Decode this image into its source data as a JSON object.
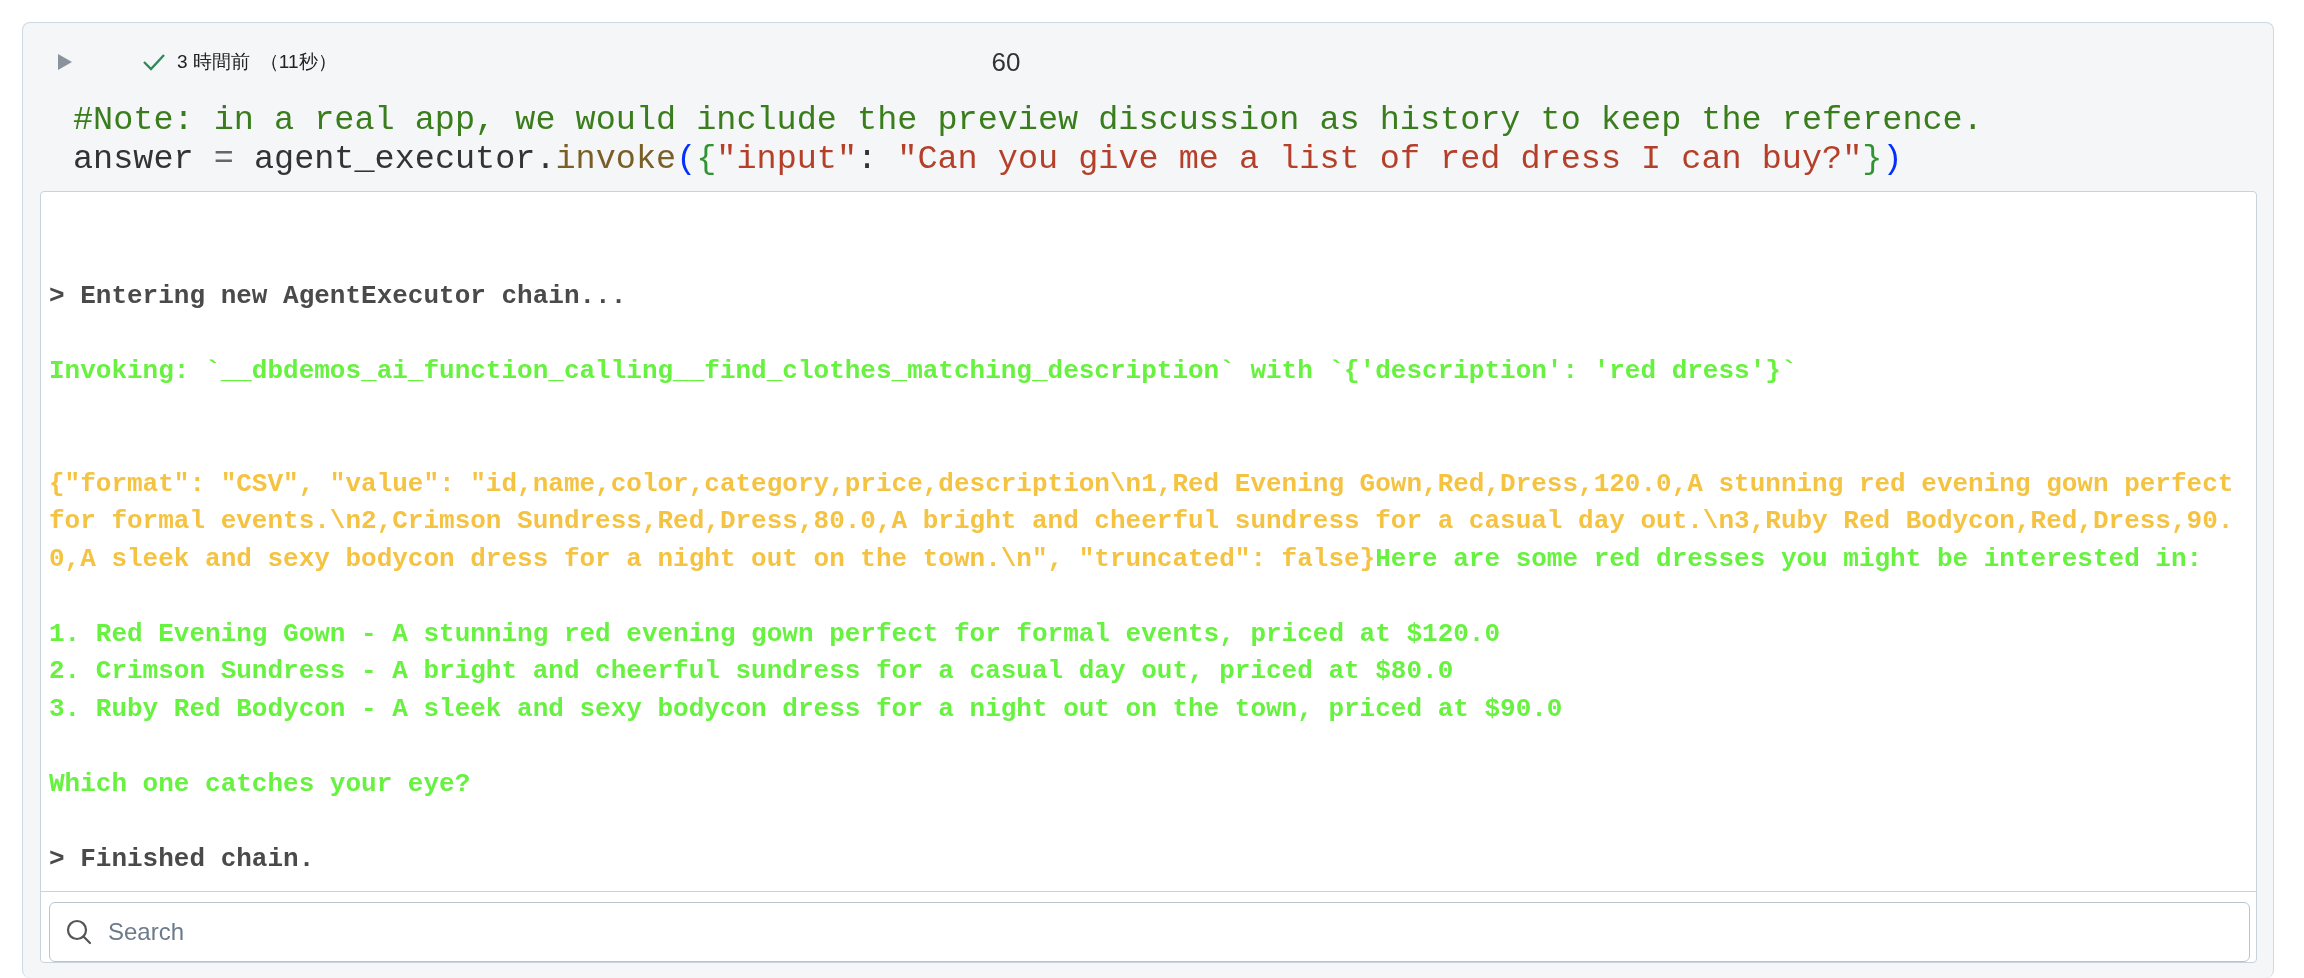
{
  "cell": {
    "status": {
      "succeeded": true,
      "time": "3 時間前",
      "duration": "（11秒）"
    },
    "count": "60",
    "code": [
      [
        {
          "kind": "comment",
          "text": "#Note: in a real app, we would include the preview discussion as history to keep the reference."
        }
      ],
      [
        {
          "kind": "name",
          "text": "answer "
        },
        {
          "kind": "operator",
          "text": "="
        },
        {
          "kind": "name",
          "text": " agent_executor."
        },
        {
          "kind": "function",
          "text": "invoke"
        },
        {
          "kind": "paren",
          "text": "("
        },
        {
          "kind": "brace",
          "text": "{"
        },
        {
          "kind": "string",
          "text": "\"input\""
        },
        {
          "kind": "name",
          "text": ": "
        },
        {
          "kind": "string",
          "text": "\"Can you give me a list of red dress I can buy?\""
        },
        {
          "kind": "brace",
          "text": "}"
        },
        {
          "kind": "paren",
          "text": ")"
        }
      ]
    ],
    "output": [
      {
        "kind": "text",
        "segments": [
          {
            "kind": "chain",
            "text": "> Entering new AgentExecutor chain..."
          }
        ]
      },
      {
        "kind": "blank"
      },
      {
        "kind": "text",
        "segments": [
          {
            "kind": "agent",
            "text": "Invoking: `__dbdemos_ai_function_calling__find_clothes_matching_description` with `{'description': 'red dress'}`"
          }
        ]
      },
      {
        "kind": "blank"
      },
      {
        "kind": "blank"
      },
      {
        "kind": "text",
        "segments": [
          {
            "kind": "tool",
            "text": "{\"format\": \"CSV\", \"value\": \"id,name,color,category,price,description\\n1,Red Evening Gown,Red,Dress,120.0,A stunning red evening gown perfect for formal events.\\n2,Crimson Sundress,Red,Dress,80.0,A bright and cheerful sundress for a casual day out.\\n3,Ruby Red Bodycon,Red,Dress,90.0,A sleek and sexy bodycon dress for a night out on the town.\\n\", \"truncated\": false}"
          },
          {
            "kind": "agent",
            "text": "Here are some red dresses you might be interested in:"
          }
        ]
      },
      {
        "kind": "blank"
      },
      {
        "kind": "text",
        "segments": [
          {
            "kind": "agent",
            "text": "1. Red Evening Gown - A stunning red evening gown perfect for formal events, priced at $120.0"
          }
        ]
      },
      {
        "kind": "text",
        "segments": [
          {
            "kind": "agent",
            "text": "2. Crimson Sundress - A bright and cheerful sundress for a casual day out, priced at $80.0"
          }
        ]
      },
      {
        "kind": "text",
        "segments": [
          {
            "kind": "agent",
            "text": "3. Ruby Red Bodycon - A sleek and sexy bodycon dress for a night out on the town, priced at $90.0"
          }
        ]
      },
      {
        "kind": "blank"
      },
      {
        "kind": "text",
        "segments": [
          {
            "kind": "agent",
            "text": "Which one catches your eye?"
          }
        ]
      },
      {
        "kind": "blank"
      },
      {
        "kind": "text",
        "segments": [
          {
            "kind": "chain",
            "text": "> Finished chain."
          }
        ]
      }
    ],
    "search": {
      "placeholder": "Search"
    }
  }
}
